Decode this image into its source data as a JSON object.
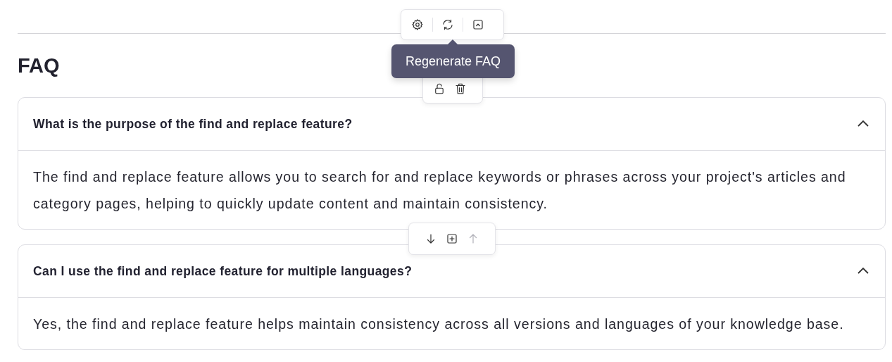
{
  "toolbar": [
    {
      "kind": "settings"
    },
    {
      "kind": "regenerate"
    },
    {
      "kind": "collapse"
    }
  ],
  "tooltip": "Regenerate FAQ",
  "heading": "FAQ",
  "item_actions": [
    {
      "kind": "lock"
    },
    {
      "kind": "delete"
    }
  ],
  "items": [
    {
      "question": "What is the purpose of the find and replace feature?",
      "answer": "The find and replace feature allows you to search for and replace keywords or phrases across your project's articles and category pages, helping to quickly update content and maintain consistency.",
      "expanded": true
    },
    {
      "question": "Can I use the find and replace feature for multiple languages?",
      "answer": "Yes, the find and replace feature helps maintain consistency across all versions and languages of your knowledge base.",
      "expanded": true
    }
  ],
  "insert_actions": [
    {
      "kind": "move-down",
      "disabled": false
    },
    {
      "kind": "add",
      "disabled": false
    },
    {
      "kind": "move-up",
      "disabled": true
    }
  ]
}
